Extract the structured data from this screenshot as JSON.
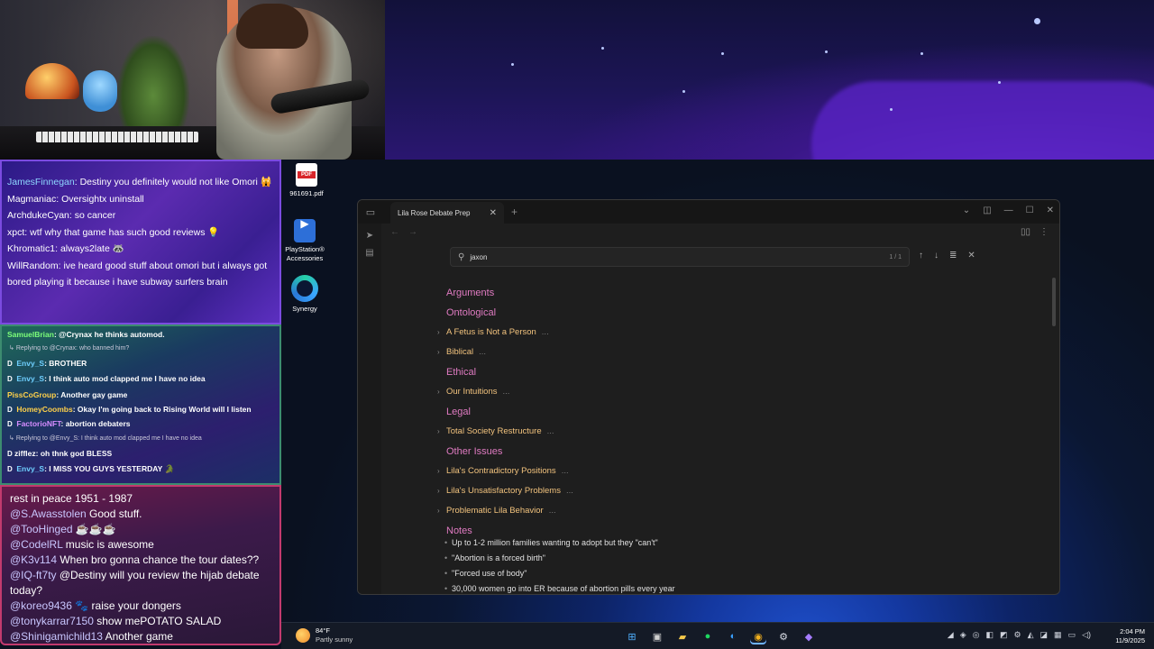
{
  "chat_top": [
    {
      "user": "JamesFinnegan",
      "text": "Destiny you definitely would not like Omori 🙀"
    },
    {
      "user": "Magmaniac",
      "text": "Oversightx uninstall"
    },
    {
      "user": "ArchdukeCyan",
      "text": "so cancer"
    },
    {
      "user": "xpct",
      "text": "wtf why that game has such good reviews 💡"
    },
    {
      "user": "Khromatic1",
      "text": "always2late 🦝"
    },
    {
      "user": "WillRandom",
      "text": "ive heard good stuff about omori but i always got bored playing it because i have subway surfers brain"
    }
  ],
  "chat_mid": [
    {
      "user": "SamuelBrian",
      "user_color": "#7dff7a",
      "text": "@Crynax he thinks automod."
    },
    {
      "reply": "Replying to @Crynax: who banned him?"
    },
    {
      "badge": "D",
      "user": "Envy_S",
      "user_color": "#6fd0ff",
      "text": "BROTHER"
    },
    {
      "badge": "D",
      "user": "Envy_S",
      "user_color": "#6fd0ff",
      "text": "I think auto mod clapped me I have no idea"
    },
    {
      "user": "PissCoGroup",
      "user_color": "#ffd14a",
      "text": "Another gay game"
    },
    {
      "badge": "D",
      "user": "HomeyCoombs",
      "user_color": "#ffd14a",
      "text": "Okay I'm going back to Rising World will I listen"
    },
    {
      "badge": "D",
      "user": "FactorioNFT",
      "user_color": "#d58cff",
      "text": "abortion debaters"
    },
    {
      "reply": "Replying to @Envy_S: I think auto mod clapped me I have no idea"
    },
    {
      "badge": "D",
      "user": "zifflez",
      "user_color": "#ffffff",
      "text": "oh thnk god BLESS"
    },
    {
      "badge": "D",
      "user": "Envy_S",
      "user_color": "#6fd0ff",
      "text": "I MISS YOU GUYS YESTERDAY 🐊"
    }
  ],
  "chat_bottom": [
    {
      "user": "",
      "text": "rest in peace 1951 - 1987"
    },
    {
      "user": "@S.Awasstolen",
      "text": "Good stuff."
    },
    {
      "user": "@TooHinged",
      "text": "☕☕☕"
    },
    {
      "user": "@CodelRL",
      "text": "music is awesome"
    },
    {
      "user": "@K3v114",
      "text": "When bro gonna chance the tour dates??"
    },
    {
      "user": "@IQ-ft7ty",
      "text": "@Destiny will you review the hijab debate today?"
    },
    {
      "user": "@koreo9436",
      "text": "🐾 raise your dongers"
    },
    {
      "user": "@tonykarrar7150",
      "text": "show mePOTATO SALAD"
    },
    {
      "user": "@Shinigamichild13",
      "text": "Another game"
    }
  ],
  "desktop": {
    "icons": [
      {
        "label": "961691.pdf",
        "icon": "pdf-file-icon",
        "badge": "PDF"
      },
      {
        "label": "PlayStation® Accessories",
        "icon": "playstation-icon"
      },
      {
        "label": "Synergy",
        "icon": "synergy-icon"
      }
    ]
  },
  "window": {
    "tab_title": "Lila Rose Debate Prep",
    "search": {
      "value": "jaxon",
      "count": "1 / 1"
    },
    "outline": [
      {
        "kind": "heading",
        "text": "Arguments"
      },
      {
        "kind": "heading",
        "text": "Ontological"
      },
      {
        "kind": "item",
        "text": "A Fetus is Not a Person"
      },
      {
        "kind": "item",
        "text": "Biblical"
      },
      {
        "kind": "heading",
        "text": "Ethical"
      },
      {
        "kind": "item",
        "text": "Our Intuitions"
      },
      {
        "kind": "heading",
        "text": "Legal"
      },
      {
        "kind": "item",
        "text": "Total Society Restructure"
      },
      {
        "kind": "heading",
        "text": "Other Issues"
      },
      {
        "kind": "item",
        "text": "Lila's Contradictory Positions"
      },
      {
        "kind": "item",
        "text": "Lila's Unsatisfactory Problems"
      },
      {
        "kind": "item",
        "text": "Problematic Lila Behavior"
      },
      {
        "kind": "heading",
        "text": "Notes"
      }
    ],
    "notes": [
      "Up to 1-2 million families wanting to adopt but they \"can't\"",
      "\"Abortion is a forced birth\"",
      "\"Forced use of body\"",
      "30,000 women go into ER because of abortion pills every year"
    ],
    "more_marker": "..."
  },
  "taskbar": {
    "weather_temp": "84°F",
    "weather_cond": "Partly sunny",
    "time": "2:04 PM",
    "date": "11/9/2025",
    "apps": [
      "windows-start-icon",
      "task-view-icon",
      "file-explorer-icon",
      "spotify-icon",
      "edge-icon",
      "chrome-icon",
      "steam-icon",
      "obsidian-icon"
    ]
  },
  "colors": {
    "heading": "#e07bc2",
    "item": "#f1c27d",
    "accent": "#6fb3ff"
  }
}
